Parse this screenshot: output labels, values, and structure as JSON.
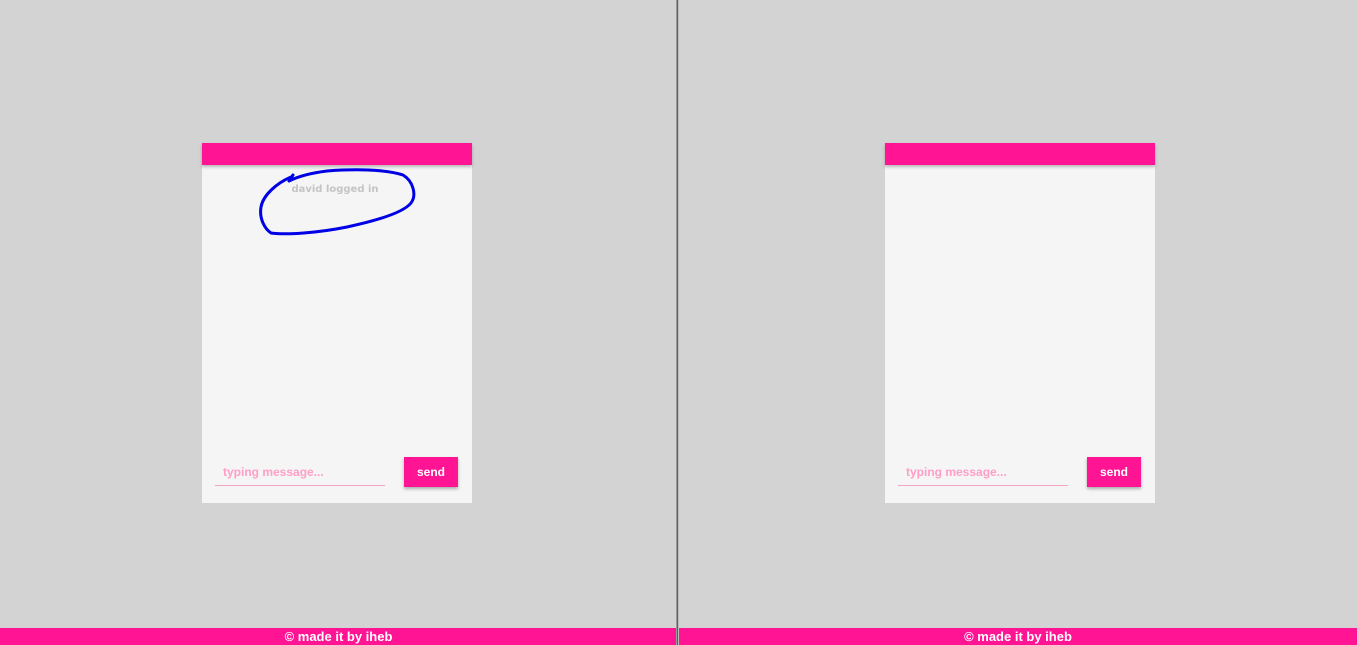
{
  "windows": [
    {
      "id": "left",
      "chat": {
        "messages": [
          "david logged in"
        ],
        "input_placeholder": "typing message...",
        "input_value": "",
        "send_label": "send"
      },
      "footer_text": "© made it by iheb"
    },
    {
      "id": "right",
      "chat": {
        "messages": [],
        "input_placeholder": "typing message...",
        "input_value": "",
        "send_label": "send"
      },
      "footer_text": "© made it by iheb"
    }
  ],
  "colors": {
    "accent": "#ff1493",
    "page_background": "#d3d3d3",
    "chat_background": "#f5f5f5",
    "annotation": "#0000e6"
  }
}
